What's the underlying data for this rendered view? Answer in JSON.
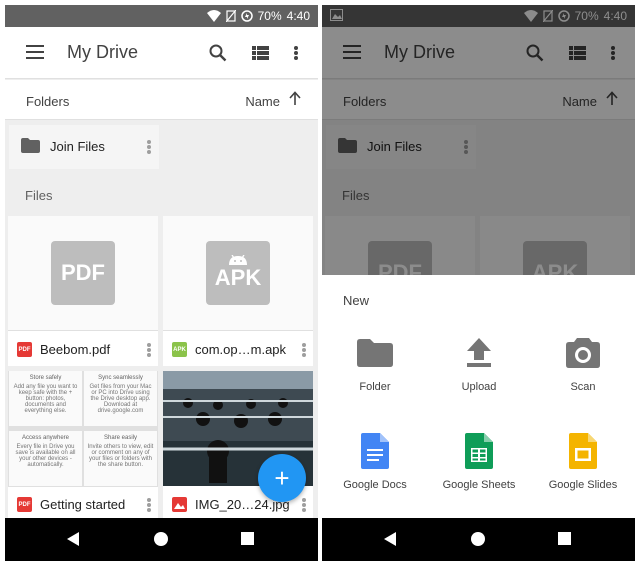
{
  "status": {
    "battery": "70%",
    "time": "4:40",
    "image_icon": "image-icon"
  },
  "appbar": {
    "title": "My Drive",
    "menu_icon": "menu-icon",
    "search_icon": "search-icon",
    "view_icon": "list-view-icon",
    "more_icon": "more-vert-icon"
  },
  "sortbar": {
    "folders_label": "Folders",
    "sort_label": "Name"
  },
  "folders": [
    {
      "name": "Join Files"
    }
  ],
  "files_label": "Files",
  "files": [
    {
      "name": "Beebom.pdf",
      "badge": "PDF",
      "type": "PDF"
    },
    {
      "name": "com.op…m.apk",
      "badge": "APK",
      "type": "APK"
    },
    {
      "name": "Getting started",
      "type": "PDF"
    },
    {
      "name": "IMG_20…24.jpg",
      "type": "IMG"
    }
  ],
  "getting_started_cells": [
    {
      "heading": "Store safely",
      "text": "Add any file you want to keep safe with the + button: photos, documents and everything else."
    },
    {
      "heading": "Sync seamlessly",
      "text": "Get files from your Mac or PC into Drive using the Drive desktop app. Download at drive.google.com"
    },
    {
      "heading": "Access anywhere",
      "text": "Every file in Drive you save is available on all your other devices - automatically."
    },
    {
      "heading": "Share easily",
      "text": "Invite others to view, edit or comment on any of your files or folders with the share button."
    }
  ],
  "fab": {
    "label": "+"
  },
  "new_sheet": {
    "title": "New",
    "items": [
      {
        "label": "Folder",
        "icon": "folder-icon"
      },
      {
        "label": "Upload",
        "icon": "upload-icon"
      },
      {
        "label": "Scan",
        "icon": "camera-icon"
      },
      {
        "label": "Google Docs",
        "icon": "google-docs-icon"
      },
      {
        "label": "Google Sheets",
        "icon": "google-sheets-icon"
      },
      {
        "label": "Google Slides",
        "icon": "google-slides-icon"
      }
    ]
  },
  "colors": {
    "fab": "#2196f3",
    "pdf_red": "#e53935",
    "apk_green": "#8bc34a",
    "docs_blue": "#4285f4",
    "sheets_green": "#0f9d58",
    "slides_yellow": "#f4b400"
  }
}
